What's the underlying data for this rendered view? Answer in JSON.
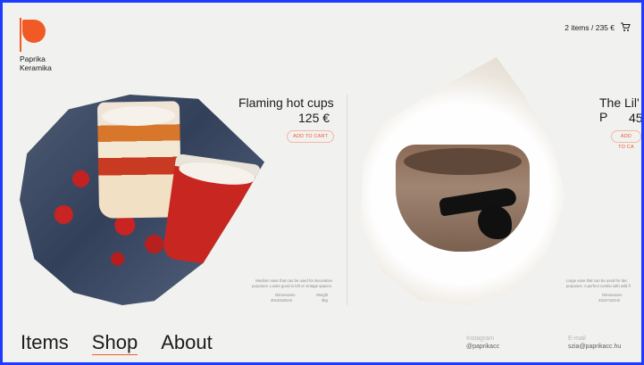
{
  "brand": {
    "name_line1": "Paprika",
    "name_line2": "Keramika",
    "accent": "#f15a24"
  },
  "cart": {
    "summary": "2 items / 235 €",
    "icon": "cart-icon"
  },
  "products": [
    {
      "title": "Flaming hot cups",
      "price": "125 €",
      "add_to_cart_label": "ADD TO CART",
      "description_line1": "Medium vase that can be used for decorative",
      "description_line2": "purposes. Looks good in loft or vintage spaces.",
      "dimensions_label": "Dimensions",
      "dimensions_value": "30x40x25cm",
      "weight_label": "Weight",
      "weight_value": "3kg"
    },
    {
      "title": "The Lil' P",
      "price": "45",
      "add_to_cart_label": "ADD TO CA",
      "description_line1": "Large vase that can be used for dec",
      "description_line2": "purposes. A perfect combo with wild fl",
      "dimensions_label": "Dimensions",
      "dimensions_value": "43x37x22cm"
    }
  ],
  "nav": {
    "items": "Items",
    "shop": "Shop",
    "about": "About"
  },
  "contact": {
    "instagram_label": "Instagram",
    "instagram_value": "@paprikacc",
    "email_label": "E-mail",
    "email_value": "szia@paprikacc.hu"
  }
}
